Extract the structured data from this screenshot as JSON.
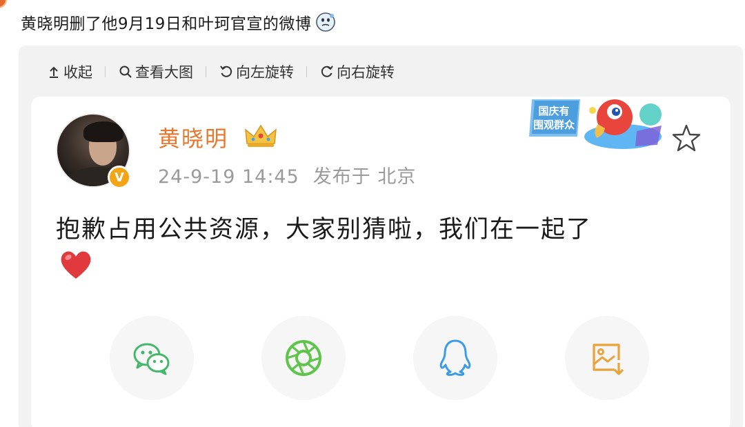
{
  "post": {
    "title": "黄晓明删了他9月19日和叶珂官宣的微博",
    "title_emoji": "thinking-face-emoji"
  },
  "toolbar": {
    "collapse_label": "收起",
    "view_large_label": "查看大图",
    "rotate_left_label": "向左旋转",
    "rotate_right_label": "向右旋转"
  },
  "weibo": {
    "user_name": "黄晓明",
    "verified_badge": "V",
    "date": "24-9-19 14:45",
    "published_at": "发布于 北京",
    "content": "抱歉占用公共资源，大家别猜啦，我们在一起了",
    "promo_text_line1": "国庆有",
    "promo_text_line2": "围观群众",
    "icons": {
      "crown": "crown-icon",
      "star": "star-icon",
      "heart": "heart-emoji"
    }
  },
  "share_actions": [
    {
      "name": "wechat",
      "icon": "wechat-icon"
    },
    {
      "name": "moments",
      "icon": "moments-icon"
    },
    {
      "name": "qq",
      "icon": "qq-icon"
    },
    {
      "name": "save-image",
      "icon": "save-image-icon"
    }
  ],
  "colors": {
    "username": "#e8772e",
    "meta_text": "#9a9a9a",
    "wechat": "#45b76b",
    "moments": "#5fc44a",
    "qq": "#3a9be6",
    "save": "#e8a33a",
    "panel_bg": "#f2f2f2"
  }
}
